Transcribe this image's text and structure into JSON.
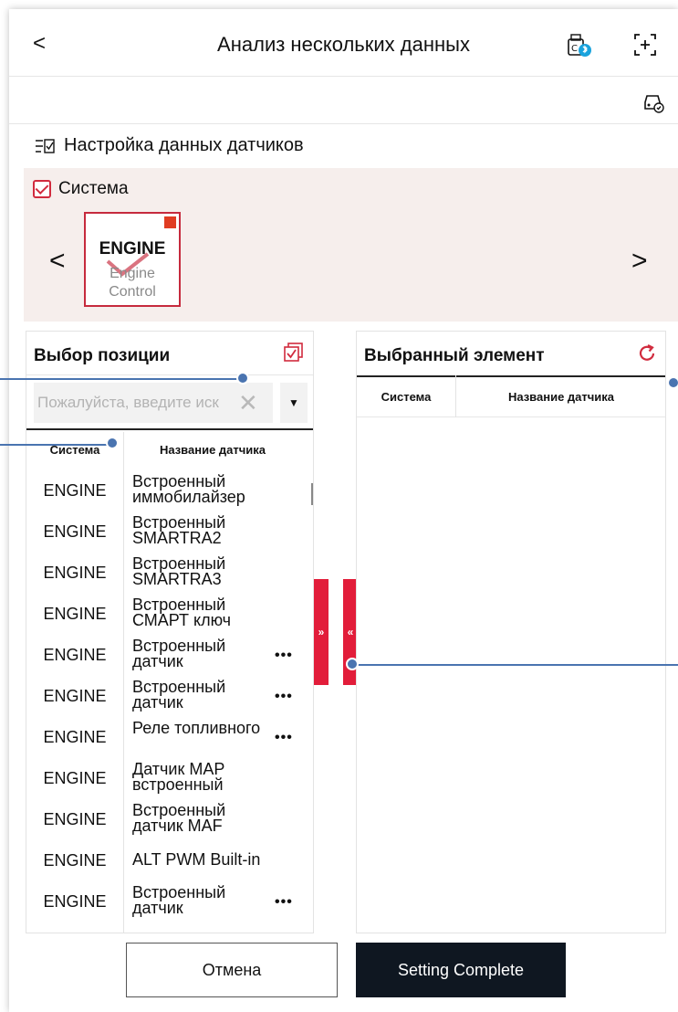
{
  "header": {
    "title": "Анализ нескольких данных",
    "back_icon": "chevron-left-icon",
    "bluetooth_device_icon": "vci-bluetooth-icon",
    "expand_icon": "expand-icon"
  },
  "subbar": {
    "vehicle_icon": "vehicle-check-icon"
  },
  "sensor_settings": {
    "title": "Настройка данных датчиков",
    "icon": "checklist-icon"
  },
  "system": {
    "label": "Система",
    "card": {
      "name": "ENGINE",
      "description": "Engine Control",
      "selected": true
    }
  },
  "selection_panel": {
    "title": "Выбор позиции",
    "search_placeholder": "Пожалуйста, введите иск",
    "columns": {
      "system": "Система",
      "sensor_name": "Название датчика"
    },
    "rows": [
      {
        "system": "ENGINE",
        "name": "Встроенный иммобилайзер",
        "more": ""
      },
      {
        "system": "ENGINE",
        "name": "Встроенный SMARTRA2",
        "more": ""
      },
      {
        "system": "ENGINE",
        "name": "Встроенный SMARTRA3",
        "more": ""
      },
      {
        "system": "ENGINE",
        "name": "Встроенный СМАРТ ключ",
        "more": ""
      },
      {
        "system": "ENGINE",
        "name": "Встроенный датчик",
        "more": "•••"
      },
      {
        "system": "ENGINE",
        "name": "Встроенный датчик",
        "more": "•••"
      },
      {
        "system": "ENGINE",
        "name": "Реле топливного",
        "more": "•••"
      },
      {
        "system": "ENGINE",
        "name": "Датчик MAP встроенный",
        "more": ""
      },
      {
        "system": "ENGINE",
        "name": "Встроенный датчик MAF",
        "more": ""
      },
      {
        "system": "ENGINE",
        "name": "ALT PWM Built-in",
        "more": ""
      },
      {
        "system": "ENGINE",
        "name": "Встроенный датчик",
        "more": "•••"
      }
    ]
  },
  "transfer": {
    "add": "»",
    "remove": "«"
  },
  "selected_panel": {
    "title": "Выбранный элемент",
    "columns": {
      "system": "Система",
      "sensor_name": "Название датчика"
    },
    "refresh_icon": "refresh-icon"
  },
  "footer": {
    "cancel_label": "Отмена",
    "confirm_label": "Setting Complete"
  },
  "colors": {
    "accent": "#e21d3a",
    "dark_button": "#0f1721",
    "panel_bg": "#f6eeec",
    "callout": "#4a74b0"
  }
}
